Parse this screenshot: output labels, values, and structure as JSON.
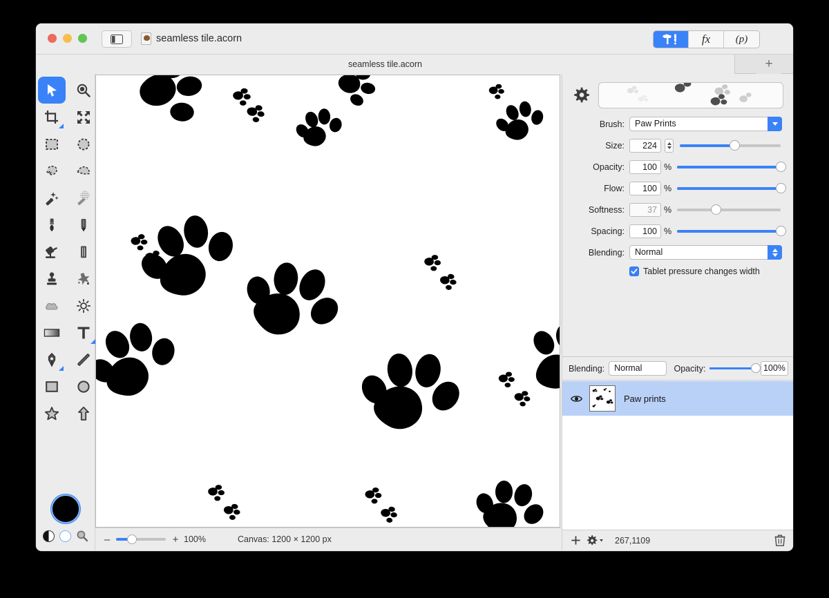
{
  "window": {
    "app": "Acorn",
    "document_title": "seamless tile.acorn",
    "tab_title": "seamless tile.acorn",
    "add_tab_label": "+",
    "traffic_lights": [
      "close",
      "minimize",
      "maximize"
    ],
    "sidebar_toggle_icon": "sidebar-toggle-icon",
    "doc_icon": "acorn-document-icon"
  },
  "segmented_control": {
    "items": [
      {
        "id": "tools",
        "label": "",
        "icon": "hammer-pen-icon",
        "active": true
      },
      {
        "id": "filters",
        "label": "fx",
        "icon": "fx-icon",
        "active": false
      },
      {
        "id": "palette",
        "label": "(p)",
        "icon": "palette-icon",
        "active": false
      }
    ]
  },
  "tools": {
    "selected": "move",
    "items": [
      {
        "id": "move",
        "icon": "move-arrow-icon",
        "selected": true,
        "group": false
      },
      {
        "id": "zoom",
        "icon": "zoom-magnifier-icon",
        "selected": false,
        "group": false
      },
      {
        "id": "crop",
        "icon": "crop-icon",
        "selected": false,
        "group": true
      },
      {
        "id": "transform",
        "icon": "transform-arrows-icon",
        "selected": false,
        "group": false
      },
      {
        "id": "rect-select",
        "icon": "rectangle-select-icon",
        "selected": false,
        "group": false
      },
      {
        "id": "ellipse-select",
        "icon": "ellipse-select-icon",
        "selected": false,
        "group": false
      },
      {
        "id": "lasso",
        "icon": "lasso-icon",
        "selected": false,
        "group": false
      },
      {
        "id": "polygon-lasso",
        "icon": "polygon-lasso-icon",
        "selected": false,
        "group": false
      },
      {
        "id": "magic-wand",
        "icon": "magic-wand-icon",
        "selected": false,
        "group": false
      },
      {
        "id": "pattern-wand",
        "icon": "pattern-wand-icon",
        "selected": false,
        "group": false
      },
      {
        "id": "brush",
        "icon": "paintbrush-icon",
        "selected": false,
        "group": false
      },
      {
        "id": "pencil",
        "icon": "pencil-icon",
        "selected": false,
        "group": false
      },
      {
        "id": "paint-bucket",
        "icon": "paint-bucket-icon",
        "selected": false,
        "group": false
      },
      {
        "id": "eraser",
        "icon": "eraser-icon",
        "selected": false,
        "group": false
      },
      {
        "id": "clone-stamp",
        "icon": "clone-stamp-icon",
        "selected": false,
        "group": false
      },
      {
        "id": "smudge",
        "icon": "smudge-icon",
        "selected": false,
        "group": false
      },
      {
        "id": "blur",
        "icon": "blur-cloud-icon",
        "selected": false,
        "group": false
      },
      {
        "id": "dodge",
        "icon": "dodge-sun-icon",
        "selected": false,
        "group": false
      },
      {
        "id": "gradient",
        "icon": "gradient-icon",
        "selected": false,
        "group": false
      },
      {
        "id": "text",
        "icon": "text-tool-icon",
        "selected": false,
        "group": true
      },
      {
        "id": "pen",
        "icon": "pen-nib-icon",
        "selected": false,
        "group": true
      },
      {
        "id": "line",
        "icon": "line-icon",
        "selected": false,
        "group": false
      },
      {
        "id": "rectangle",
        "icon": "rectangle-shape-icon",
        "selected": false,
        "group": false
      },
      {
        "id": "ellipse",
        "icon": "ellipse-shape-icon",
        "selected": false,
        "group": false
      },
      {
        "id": "star",
        "icon": "star-shape-icon",
        "selected": false,
        "group": false
      },
      {
        "id": "arrow",
        "icon": "arrow-shape-icon",
        "selected": false,
        "group": false
      }
    ],
    "color_well": {
      "foreground": "#000000",
      "focus_ring": "#3a82f7"
    },
    "mini_controls": [
      {
        "id": "swap-colors",
        "icon": "swap-colors-icon"
      },
      {
        "id": "background-color",
        "icon": "white-swatch-icon"
      },
      {
        "id": "color-picker",
        "icon": "magnifier-picker-icon"
      }
    ]
  },
  "canvas": {
    "zoom_percent": "100%",
    "zoom_slider_value": 32,
    "size_label": "Canvas: 1200 × 1200 px",
    "minus_label": "–",
    "plus_label": "+",
    "background": "#ffffff",
    "paw_color": "#000000"
  },
  "brush_panel": {
    "gear_icon": "gear-icon",
    "preview_name": "brush-preview-strip",
    "brush": {
      "label": "Brush:",
      "value": "Paw Prints"
    },
    "size": {
      "label": "Size:",
      "value": "224",
      "slider_percent": 54,
      "enabled": true
    },
    "opacity": {
      "label": "Opacity:",
      "value": "100",
      "unit": "%",
      "slider_percent": 100,
      "enabled": true
    },
    "flow": {
      "label": "Flow:",
      "value": "100",
      "unit": "%",
      "slider_percent": 100,
      "enabled": true
    },
    "softness": {
      "label": "Softness:",
      "value": "37",
      "unit": "%",
      "slider_percent": 37,
      "enabled": false
    },
    "spacing": {
      "label": "Spacing:",
      "value": "100",
      "unit": "%",
      "slider_percent": 100,
      "enabled": true
    },
    "blending": {
      "label": "Blending:",
      "value": "Normal"
    },
    "tablet_pressure": {
      "label": "Tablet pressure changes width",
      "checked": true
    }
  },
  "layers_panel": {
    "blending": {
      "label": "Blending:",
      "value": "Normal"
    },
    "opacity": {
      "label": "Opacity:",
      "value": "100%",
      "slider_percent": 100
    },
    "rows": [
      {
        "name": "Paw prints",
        "visible": true,
        "selected": true,
        "visibility_icon": "eye-icon",
        "thumbnail": "layer-thumbnail"
      }
    ],
    "footer": {
      "add_icon": "plus-icon",
      "settings_icon": "gear-dropdown-icon",
      "coordinates": "267,1109",
      "delete_icon": "trash-icon"
    }
  },
  "colors": {
    "accent": "#3a82f7",
    "window_bg": "#ececec",
    "selection": "#b9d1f7",
    "page_bg": "#000000"
  }
}
